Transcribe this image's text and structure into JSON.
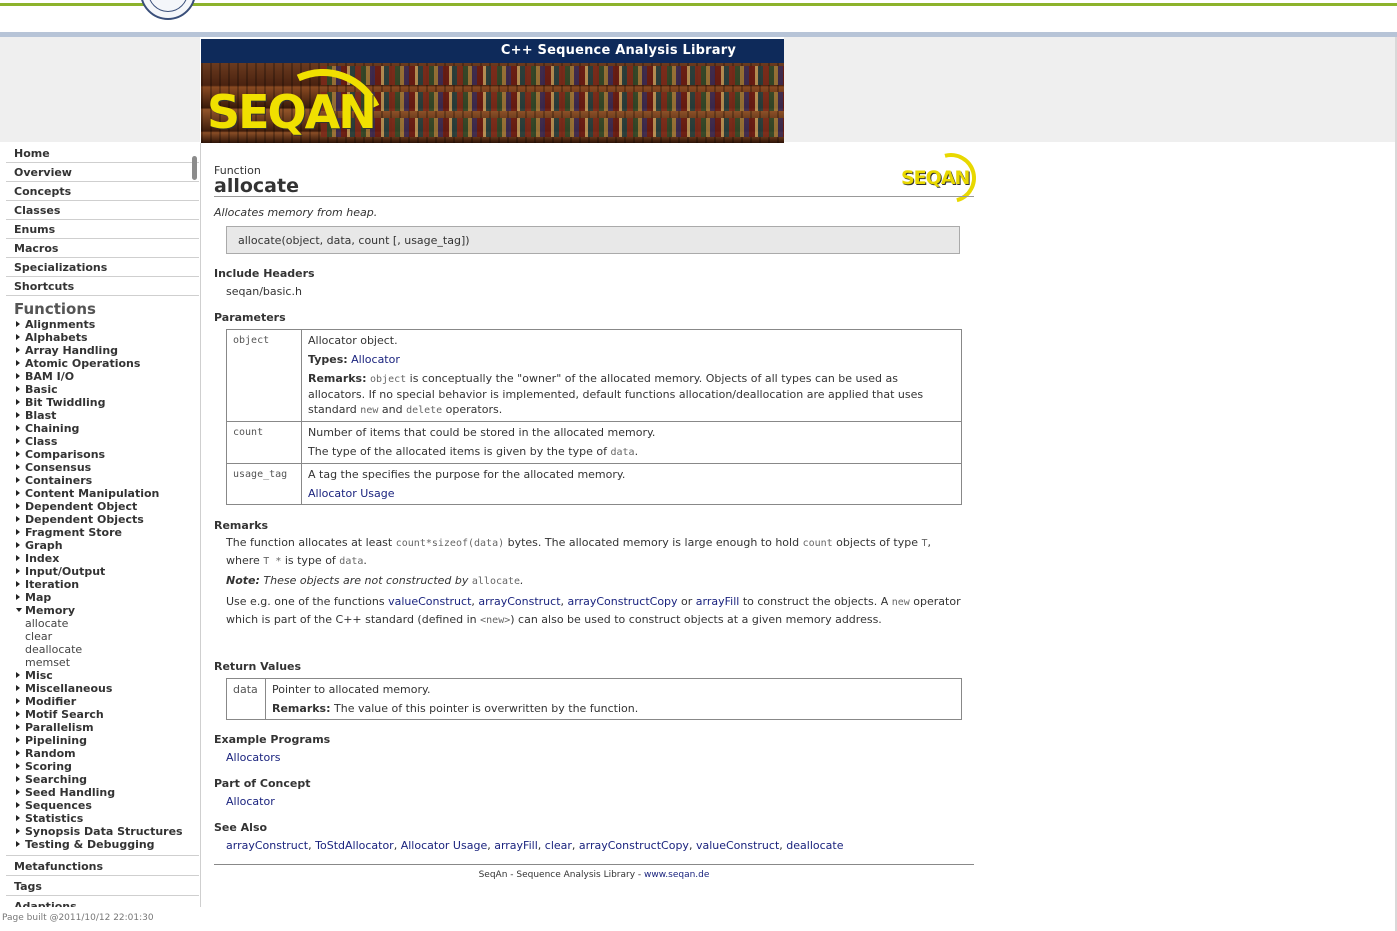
{
  "banner": {
    "title": "C++ Sequence Analysis Library",
    "logo_text": "SEQAN"
  },
  "sidebar": {
    "top_items": [
      {
        "label": "Home"
      },
      {
        "label": "Overview"
      },
      {
        "label": "Concepts"
      },
      {
        "label": "Classes"
      },
      {
        "label": "Enums"
      },
      {
        "label": "Macros"
      },
      {
        "label": "Specializations"
      },
      {
        "label": "Shortcuts"
      }
    ],
    "functions_heading": "Functions",
    "categories": [
      "Alignments",
      "Alphabets",
      "Array Handling",
      "Atomic Operations",
      "BAM I/O",
      "Basic",
      "Bit Twiddling",
      "Blast",
      "Chaining",
      "Class",
      "Comparisons",
      "Consensus",
      "Containers",
      "Content Manipulation",
      "Dependent Object",
      "Dependent Objects",
      "Fragment Store",
      "Graph",
      "Index",
      "Input/Output",
      "Iteration",
      "Map"
    ],
    "expanded_category": "Memory",
    "memory_functions": [
      "allocate",
      "clear",
      "deallocate",
      "memset"
    ],
    "categories_after": [
      "Misc",
      "Miscellaneous",
      "Modifier",
      "Motif Search",
      "Parallelism",
      "Pipelining",
      "Random",
      "Scoring",
      "Searching",
      "Seed Handling",
      "Sequences",
      "Statistics",
      "Synopsis Data Structures",
      "Testing & Debugging"
    ],
    "bottom_items": [
      {
        "label": "Metafunctions"
      },
      {
        "label": "Tags"
      },
      {
        "label": "Adaptions"
      }
    ],
    "page_built": "Page built @2011/10/12 22:01:30"
  },
  "content": {
    "kind": "Function",
    "title": "allocate",
    "summary": "Allocates memory from heap.",
    "signature": "allocate(object, data, count [, usage_tag])",
    "include_heading": "Include Headers",
    "include_file": "seqan/basic.h",
    "parameters_heading": "Parameters",
    "params": {
      "object": {
        "name": "object",
        "desc": "Allocator object.",
        "types_label": "Types:",
        "types_value": "Allocator",
        "remarks_label": "Remarks:",
        "remarks_code": "object",
        "remarks_text_1": " is conceptually the \"owner\" of the allocated memory. Objects of all types can be used as allocators. If no special behavior is implemented, default functions allocation/deallocation are applied that uses standard ",
        "remarks_code_new": "new",
        "remarks_and": " and ",
        "remarks_code_delete": "delete",
        "remarks_text_2": " operators."
      },
      "count": {
        "name": "count",
        "desc": "Number of items that could be stored in the allocated memory.",
        "desc2": "The type of the allocated items is given by the type of ",
        "desc2_code": "data",
        "desc2_end": "."
      },
      "usage_tag": {
        "name": "usage_tag",
        "desc": "A tag the specifies the purpose for the allocated memory.",
        "link": "Allocator Usage"
      }
    },
    "remarks_heading": "Remarks",
    "remarks": {
      "p1_a": "The function allocates at least ",
      "p1_code1": "count*sizeof(data)",
      "p1_b": " bytes. The allocated memory is large enough to hold ",
      "p1_code2": "count",
      "p1_c": " objects of type ",
      "p1_code3": "T",
      "p1_d": ", where ",
      "p1_code4": "T *",
      "p1_e": " is type of ",
      "p1_code5": "data",
      "p1_f": ".",
      "note_label": "Note:",
      "note_text": " These objects are not constructed by ",
      "note_code": "allocate",
      "note_end": ".",
      "p3_a": "Use e.g. one of the functions ",
      "p3_link1": "valueConstruct",
      "p3_sep1": ", ",
      "p3_link2": "arrayConstruct",
      "p3_sep2": ", ",
      "p3_link3": "arrayConstructCopy",
      "p3_or": " or ",
      "p3_link4": "arrayFill",
      "p3_b": " to construct the objects. A ",
      "p3_code1": "new",
      "p3_c": " operator which is part of the C++ standard (defined in ",
      "p3_code2": "<new>",
      "p3_d": ") can also be used to construct objects at a given memory address."
    },
    "return_heading": "Return Values",
    "return_value": {
      "name": "data",
      "desc": "Pointer to allocated memory.",
      "remarks_label": "Remarks:",
      "remarks_text": " The value of this pointer is overwritten by the function."
    },
    "examples_heading": "Example Programs",
    "example_link": "Allocators",
    "concept_heading": "Part of Concept",
    "concept_link": "Allocator",
    "see_also_heading": "See Also",
    "see_also": [
      "arrayConstruct",
      "ToStdAllocator",
      "Allocator Usage",
      "arrayFill",
      "clear",
      "arrayConstructCopy",
      "valueConstruct",
      "deallocate"
    ],
    "footer_text": "SeqAn - Sequence Analysis Library - ",
    "footer_link": "www.seqan.de"
  },
  "colors": {
    "link": "#1a237e",
    "banner_bar": "#0e2a5a",
    "logo_yellow": "#f0e000",
    "top_green": "#8db32c"
  }
}
